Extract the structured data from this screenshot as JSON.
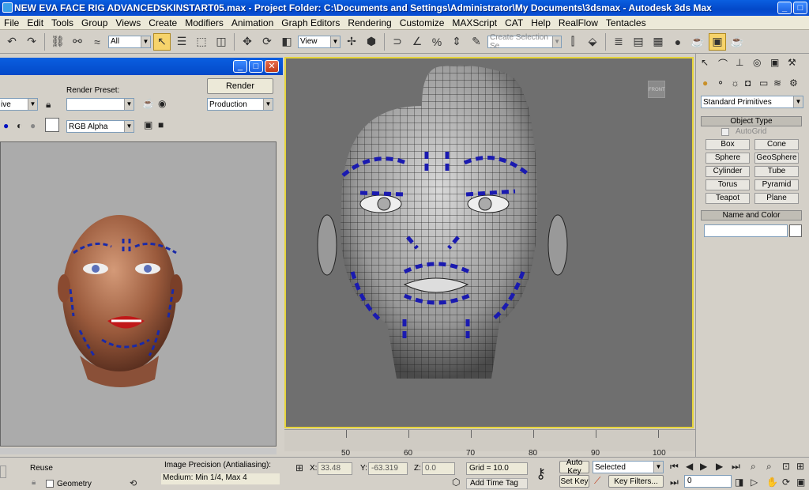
{
  "window": {
    "title": "NEW EVA FACE RIG ADVANCEDSKINSTART05.max   - Project Folder: C:\\Documents and Settings\\Administrator\\My Documents\\3dsmax   - Autodesk 3ds Max"
  },
  "menu": [
    "File",
    "Edit",
    "Tools",
    "Group",
    "Views",
    "Create",
    "Modifiers",
    "Animation",
    "Graph Editors",
    "Rendering",
    "Customize",
    "MAXScript",
    "CAT",
    "Help",
    "RealFlow",
    "Tentacles"
  ],
  "toolbar": {
    "filter_value": "All",
    "refcoord_value": "View",
    "selection_set_placeholder": "Create Selection Se"
  },
  "render_frame": {
    "render_preset_label": "Render Preset:",
    "render_button": "Render",
    "preset_value": "",
    "area_value": "ive",
    "production_value": "Production",
    "channel_value": "RGB Alpha",
    "reuse_label": "Reuse",
    "geometry_label": "Geometry",
    "image_precision_label": "Image Precision (Antialiasing):",
    "image_precision_value": "Medium: Min 1/4, Max 4"
  },
  "viewport": {
    "viewcube_label": "FRONT"
  },
  "timeline": {
    "labels": [
      "50",
      "60",
      "70",
      "80",
      "90",
      "100"
    ]
  },
  "command_panel": {
    "category_value": "Standard Primitives",
    "object_type_title": "Object Type",
    "autogrid_label": "AutoGrid",
    "buttons": [
      "Box",
      "Cone",
      "Sphere",
      "GeoSphere",
      "Cylinder",
      "Tube",
      "Torus",
      "Pyramid",
      "Teapot",
      "Plane"
    ],
    "name_color_title": "Name and Color"
  },
  "status": {
    "x_label": "X:",
    "x_value": "33.48",
    "y_label": "Y:",
    "y_value": "-63.319",
    "z_label": "Z:",
    "z_value": "0.0",
    "grid": "Grid = 10.0",
    "add_time_tag": "Add Time Tag",
    "auto_key": "Auto Key",
    "set_key": "Set Key",
    "selected": "Selected",
    "key_filters": "Key Filters...",
    "frame": "0"
  }
}
